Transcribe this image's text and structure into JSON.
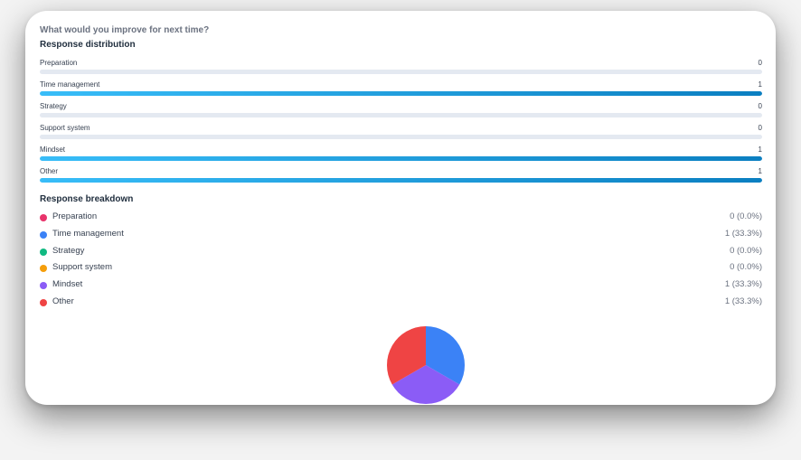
{
  "question": "What would you improve for next time?",
  "distribution_title": "Response distribution",
  "breakdown_title": "Response breakdown",
  "colors": {
    "Preparation": "#e8336b",
    "Time management": "#3b82f6",
    "Strategy": "#10b981",
    "Support system": "#f59e0b",
    "Mindset": "#8b5cf6",
    "Other": "#ef4444"
  },
  "chart_data": [
    {
      "type": "bar",
      "title": "Response distribution",
      "categories": [
        "Preparation",
        "Time management",
        "Strategy",
        "Support system",
        "Mindset",
        "Other"
      ],
      "values": [
        0,
        1,
        0,
        0,
        1,
        1
      ],
      "xlim": [
        0,
        1
      ]
    },
    {
      "type": "pie",
      "title": "Response breakdown",
      "categories": [
        "Preparation",
        "Time management",
        "Strategy",
        "Support system",
        "Mindset",
        "Other"
      ],
      "values": [
        0,
        1,
        0,
        0,
        1,
        1
      ],
      "labels": [
        "0 (0.0%)",
        "1 (33.3%)",
        "0 (0.0%)",
        "0 (0.0%)",
        "1 (33.3%)",
        "1 (33.3%)"
      ]
    }
  ]
}
